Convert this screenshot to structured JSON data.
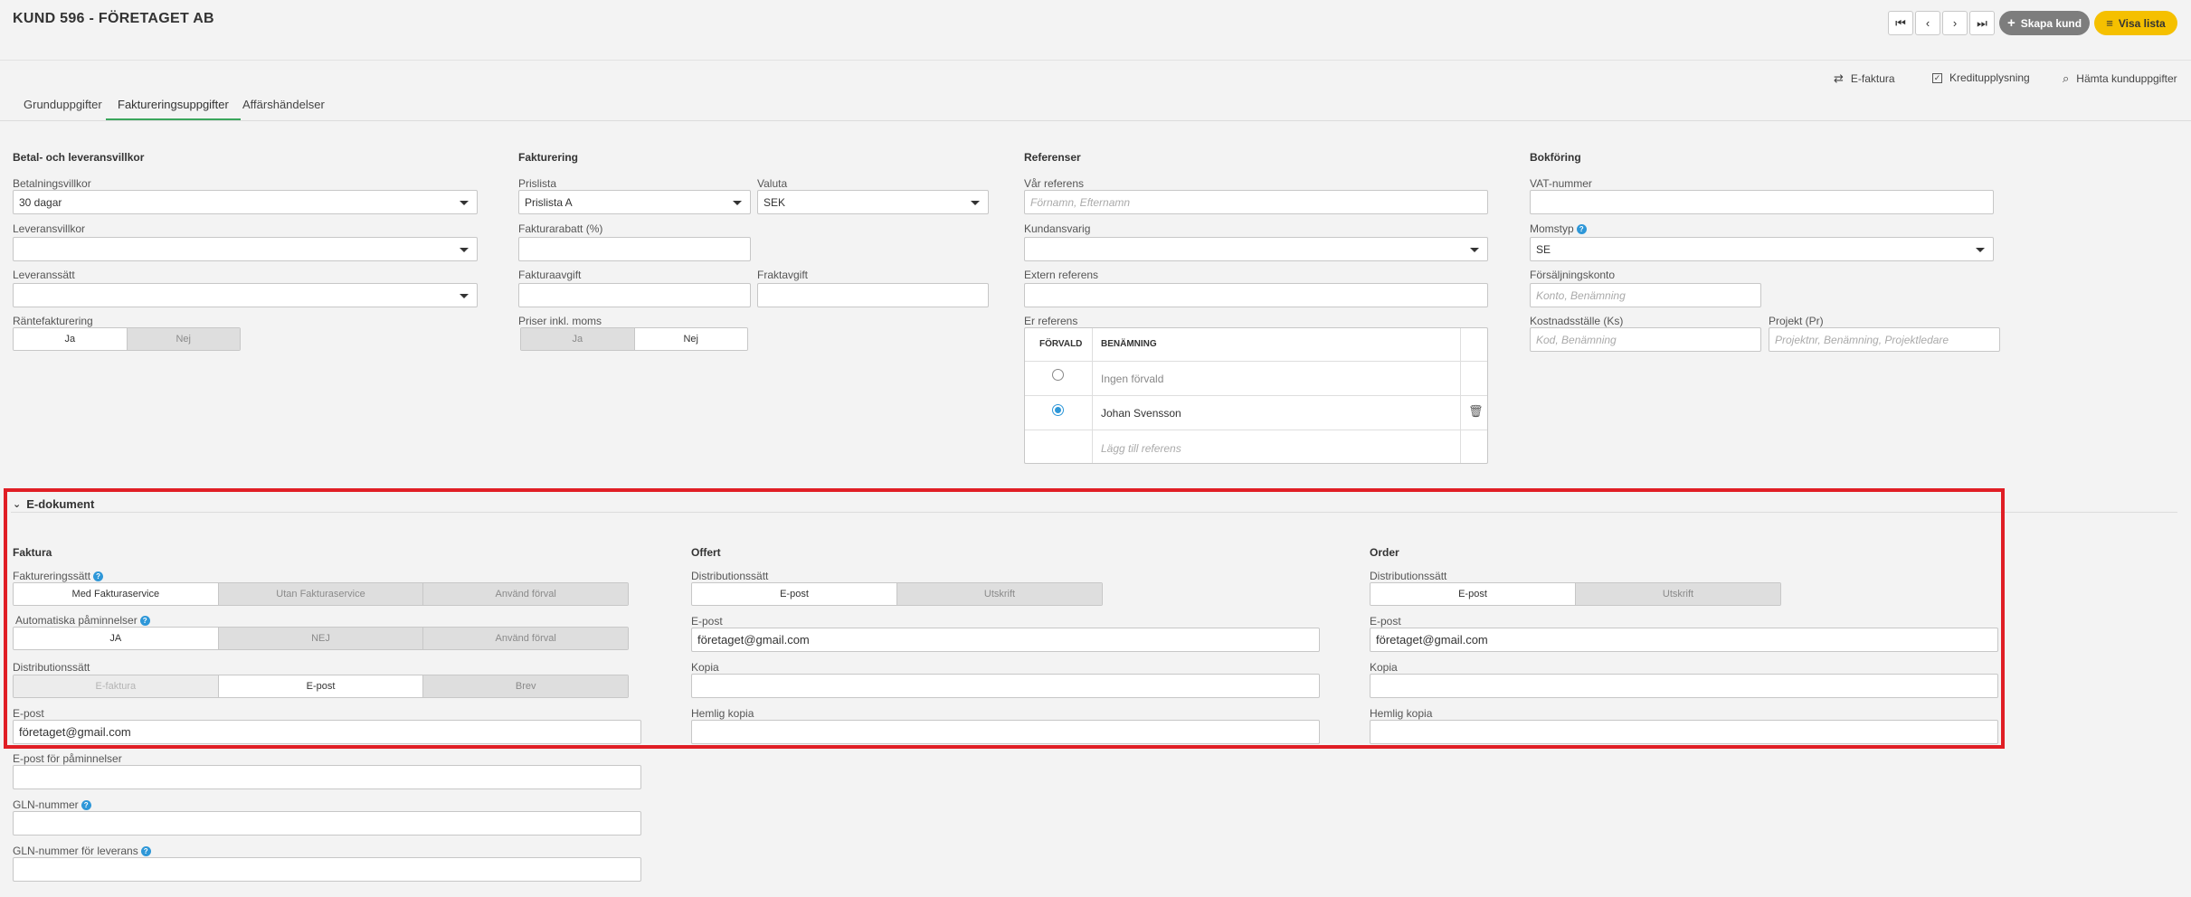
{
  "header": {
    "title": "KUND 596 - FÖRETAGET AB",
    "nav": {
      "first": "⏮",
      "prev": "‹",
      "next": "›",
      "last": "⏭"
    },
    "create_label": "Skapa kund",
    "list_label": "Visa lista",
    "colors": {
      "create": "#7d7d7d",
      "list": "#f5c000"
    }
  },
  "toolbar": {
    "efaktura": "E-faktura",
    "kredit": "Kreditupplysning",
    "hamta": "Hämta kunduppgifter"
  },
  "tabs": [
    {
      "label": "Grunduppgifter"
    },
    {
      "label": "Faktureringsuppgifter"
    },
    {
      "label": "Affärshändelser"
    }
  ],
  "betal": {
    "heading": "Betal- och leveransvillkor",
    "betalningsvillkor_label": "Betalningsvillkor",
    "betalningsvillkor_value": "30 dagar",
    "leveransvillkor_label": "Leveransvillkor",
    "leveranssatt_label": "Leveranssätt",
    "rante_label": "Räntefakturering",
    "rante_ja": "Ja",
    "rante_nej": "Nej"
  },
  "fakturering": {
    "heading": "Fakturering",
    "prislista_label": "Prislista",
    "prislista_value": "Prislista A",
    "valuta_label": "Valuta",
    "valuta_value": "SEK",
    "rabatt_label": "Fakturarabatt (%)",
    "avgift_label": "Fakturaavgift",
    "frakt_label": "Fraktavgift",
    "priser_label": "Priser inkl. moms",
    "priser_ja": "Ja",
    "priser_nej": "Nej"
  },
  "referenser": {
    "heading": "Referenser",
    "var_label": "Vår referens",
    "var_placeholder": "Förnamn, Efternamn",
    "kundansvarig_label": "Kundansvarig",
    "extern_label": "Extern referens",
    "er_label": "Er referens",
    "col_forvald": "FÖRVALD",
    "col_benamning": "BENÄMNING",
    "rows": [
      {
        "name": "Ingen förvald",
        "selected": false
      },
      {
        "name": "Johan Svensson",
        "selected": true
      }
    ],
    "add_placeholder": "Lägg till referens"
  },
  "bokforing": {
    "heading": "Bokföring",
    "vat_label": "VAT-nummer",
    "momstyp_label": "Momstyp",
    "momstyp_value": "SE",
    "forsaljning_label": "Försäljningskonto",
    "forsaljning_placeholder": "Konto, Benämning",
    "kostnad_label": "Kostnadsställe (Ks)",
    "kostnad_placeholder": "Kod, Benämning",
    "projekt_label": "Projekt (Pr)",
    "projekt_placeholder": "Projektnr, Benämning, Projektledare"
  },
  "edok": {
    "heading": "E-dokument",
    "faktura": {
      "heading": "Faktura",
      "satt_label": "Faktureringssätt",
      "satt_options": [
        "Med Fakturaservice",
        "Utan Fakturaservice",
        "Använd förval"
      ],
      "pamin_label": "Automatiska påminnelser",
      "pamin_options": [
        "JA",
        "NEJ",
        "Använd förval"
      ],
      "dist_label": "Distributionssätt",
      "dist_options": [
        "E-faktura",
        "E-post",
        "Brev"
      ],
      "epost_label": "E-post",
      "epost_value": "företaget@gmail.com",
      "epost_pamin_label": "E-post för påminnelser",
      "gln_label": "GLN-nummer",
      "gln_lev_label": "GLN-nummer för leverans"
    },
    "offert": {
      "heading": "Offert",
      "dist_label": "Distributionssätt",
      "dist_options": [
        "E-post",
        "Utskrift"
      ],
      "epost_label": "E-post",
      "epost_value": "företaget@gmail.com",
      "kopia_label": "Kopia",
      "hemlig_label": "Hemlig kopia"
    },
    "order": {
      "heading": "Order",
      "dist_label": "Distributionssätt",
      "dist_options": [
        "E-post",
        "Utskrift"
      ],
      "epost_label": "E-post",
      "epost_value": "företaget@gmail.com",
      "kopia_label": "Kopia",
      "hemlig_label": "Hemlig kopia"
    }
  }
}
